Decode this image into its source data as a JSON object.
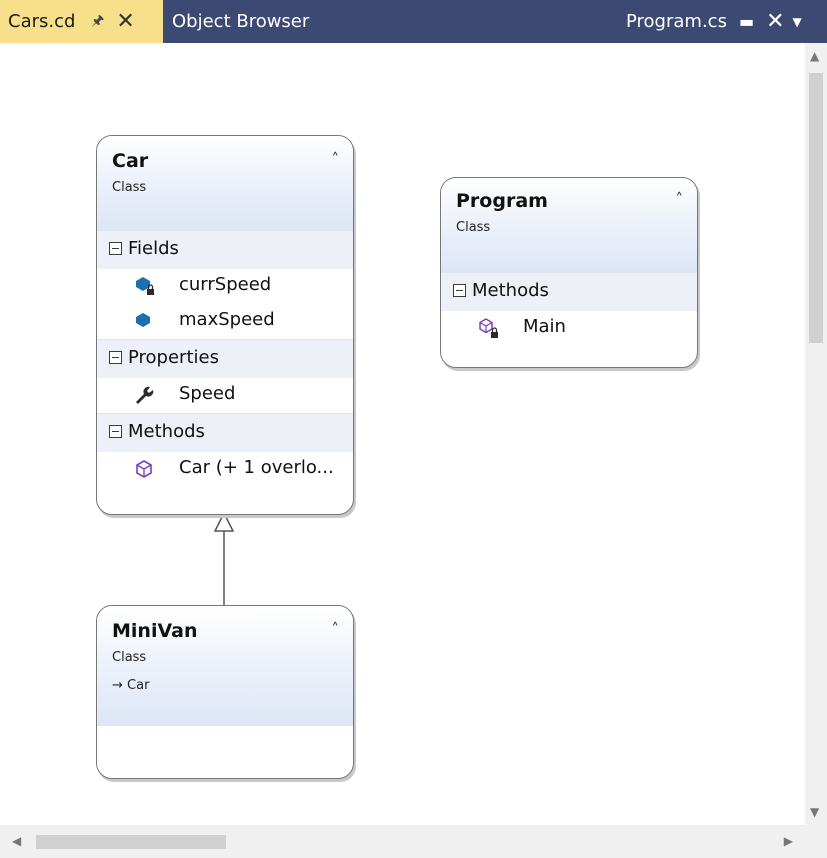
{
  "tabs": {
    "active": {
      "label": "Cars.cd",
      "pin_icon": "pin-icon",
      "close_icon": "close-icon"
    },
    "object_browser": {
      "label": "Object Browser"
    },
    "program": {
      "label": "Program.cs"
    }
  },
  "classes": {
    "car": {
      "name": "Car",
      "kind": "Class",
      "sections": {
        "fields": {
          "label": "Fields",
          "members": [
            {
              "name": "currSpeed",
              "icon": "private-field-icon"
            },
            {
              "name": "maxSpeed",
              "icon": "field-icon"
            }
          ]
        },
        "properties": {
          "label": "Properties",
          "members": [
            {
              "name": "Speed",
              "icon": "property-wrench-icon"
            }
          ]
        },
        "methods": {
          "label": "Methods",
          "members": [
            {
              "name": "Car (+ 1 overlo...",
              "icon": "method-icon"
            }
          ]
        }
      }
    },
    "program": {
      "name": "Program",
      "kind": "Class",
      "sections": {
        "methods": {
          "label": "Methods",
          "members": [
            {
              "name": "Main",
              "icon": "private-method-icon"
            }
          ]
        }
      }
    },
    "minivan": {
      "name": "MiniVan",
      "kind": "Class",
      "base": "→ Car"
    }
  },
  "colors": {
    "tabstrip_bg": "#3c4a73",
    "active_tab_bg": "#f6e08a",
    "field_icon": "#1f6fb0",
    "method_icon": "#7a3fb8"
  }
}
